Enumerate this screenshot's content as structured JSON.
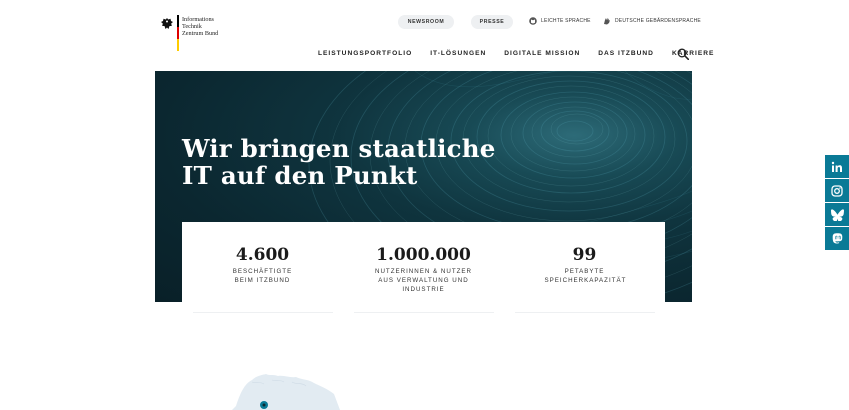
{
  "logo": {
    "lines": [
      "Informations",
      "Technik",
      "Zentrum Bund"
    ]
  },
  "meta_nav": {
    "newsroom": "NEWSROOM",
    "presse": "PRESSE",
    "leichte_sprache": "LEICHTE SPRACHE",
    "gebaerdensprache": "DEUTSCHE GEBÄRDENSPRACHE"
  },
  "main_nav": {
    "items": [
      "LEISTUNGSPORTFOLIO",
      "IT-LÖSUNGEN",
      "DIGITALE MISSION",
      "DAS ITZBUND",
      "KARRIERE"
    ]
  },
  "hero": {
    "title_line1": "Wir bringen staatliche",
    "title_line2": "IT auf den Punkt"
  },
  "stats": [
    {
      "value": "4.600",
      "label": "BESCHÄFTIGTE BEIM ITZBUND"
    },
    {
      "value": "1.000.000",
      "label": "NUTZERINNEN & NUTZER AUS VERWALTUNG UND INDUSTRIE"
    },
    {
      "value": "99",
      "label": "PETABYTE SPEICHERKAPAZITÄT"
    }
  ],
  "social": [
    "linkedin-icon",
    "instagram-icon",
    "bluesky-icon",
    "mastodon-icon"
  ],
  "colors": {
    "accent": "#0a7a96",
    "hero_dark": "#0b2730",
    "flag_black": "#000000",
    "flag_red": "#dd0000",
    "flag_gold": "#ffcc00"
  }
}
